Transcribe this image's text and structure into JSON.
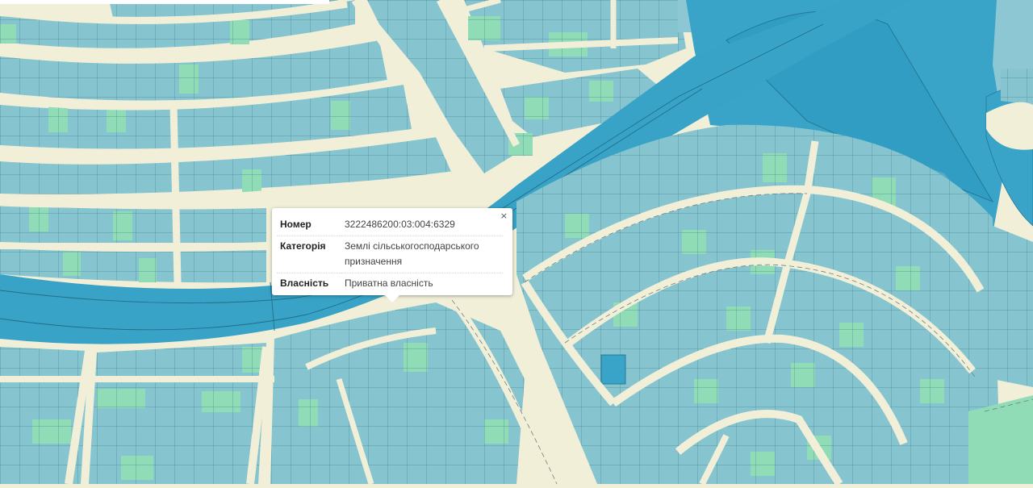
{
  "map": {
    "colors": {
      "background": "#f2efd9",
      "parcel_blue": "#86c5cf",
      "parcel_green": "#8fdcb7",
      "water": "#3aa4c8",
      "water_dark": "#2e93b9",
      "road": "#f2efd9",
      "parcel_outline": "#4a8b95"
    }
  },
  "popup": {
    "close_label": "×",
    "rows": [
      {
        "key": "Номер",
        "value": "3222486200:03:004:6329"
      },
      {
        "key": "Категорія",
        "value": "Землі сільськогосподарського призначення"
      },
      {
        "key": "Власність",
        "value": "Приватна власність"
      }
    ]
  }
}
